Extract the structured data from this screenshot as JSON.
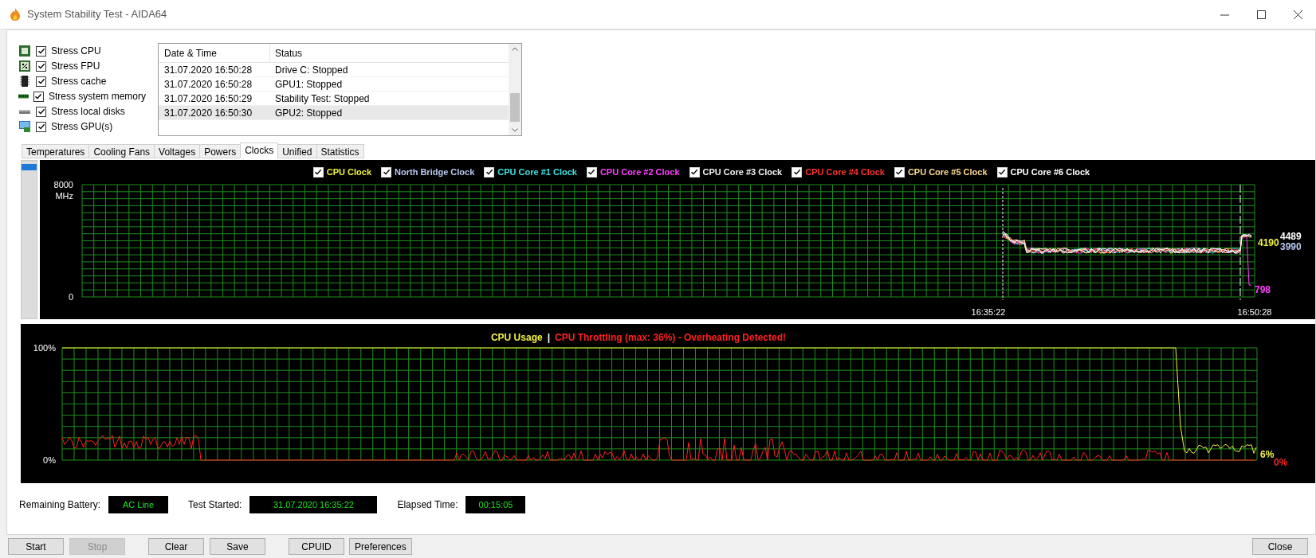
{
  "window": {
    "title": "System Stability Test - AIDA64"
  },
  "stress_options": [
    {
      "label": "Stress CPU",
      "checked": true,
      "kind": "cpu"
    },
    {
      "label": "Stress FPU",
      "checked": true,
      "kind": "fpu"
    },
    {
      "label": "Stress cache",
      "checked": true,
      "kind": "cache"
    },
    {
      "label": "Stress system memory",
      "checked": true,
      "kind": "memory"
    },
    {
      "label": "Stress local disks",
      "checked": true,
      "kind": "disk"
    },
    {
      "label": "Stress GPU(s)",
      "checked": true,
      "kind": "gpu"
    }
  ],
  "log": {
    "columns": [
      "Date & Time",
      "Status"
    ],
    "rows": [
      {
        "date_time": "31.07.2020 16:50:28",
        "status": "Drive C: Stopped",
        "selected": false
      },
      {
        "date_time": "31.07.2020 16:50:28",
        "status": "GPU1: Stopped",
        "selected": false
      },
      {
        "date_time": "31.07.2020 16:50:29",
        "status": "Stability Test: Stopped",
        "selected": false
      },
      {
        "date_time": "31.07.2020 16:50:30",
        "status": "GPU2: Stopped",
        "selected": true
      }
    ]
  },
  "tabs": [
    {
      "label": "Temperatures",
      "selected": false
    },
    {
      "label": "Cooling Fans",
      "selected": false
    },
    {
      "label": "Voltages",
      "selected": false
    },
    {
      "label": "Powers",
      "selected": false
    },
    {
      "label": "Clocks",
      "selected": true
    },
    {
      "label": "Unified",
      "selected": false
    },
    {
      "label": "Statistics",
      "selected": false
    }
  ],
  "clock_chart": {
    "legend": [
      {
        "label": "CPU Clock",
        "checked": true,
        "color": "#f0f040"
      },
      {
        "label": "North Bridge Clock",
        "checked": true,
        "color": "#b8c8f0"
      },
      {
        "label": "CPU Core #1 Clock",
        "checked": true,
        "color": "#40e0e0"
      },
      {
        "label": "CPU Core #2 Clock",
        "checked": true,
        "color": "#ff40ff"
      },
      {
        "label": "CPU Core #3 Clock",
        "checked": true,
        "color": "#f0f0f0"
      },
      {
        "label": "CPU Core #4 Clock",
        "checked": true,
        "color": "#ff3030"
      },
      {
        "label": "CPU Core #5 Clock",
        "checked": true,
        "color": "#ffd890"
      },
      {
        "label": "CPU Core #6 Clock",
        "checked": true,
        "color": "#ffffff"
      }
    ],
    "y_max_label": "8000",
    "y_unit": "MHz",
    "y_min_label": "0",
    "x_labels": [
      "16:35:22",
      "16:50:28"
    ],
    "readings": [
      {
        "text": "4489",
        "color": "#ffffff"
      },
      {
        "text": "4190",
        "color": "#f0f040"
      },
      {
        "text": "3990",
        "color": "#b8c8f0"
      },
      {
        "text": "798",
        "color": "#ff40ff"
      }
    ]
  },
  "usage_chart": {
    "legend": [
      {
        "label": "CPU Usage",
        "color": "#f0f040"
      },
      {
        "label": "|",
        "color": "#ffffff"
      },
      {
        "label": "CPU Throttling (max: 36%) - Overheating Detected!",
        "color": "#ff2020"
      }
    ],
    "y_max_label": "100%",
    "y_min_label": "0%",
    "readings": [
      {
        "text": "6%",
        "color": "#f0f040"
      },
      {
        "text": "0%",
        "color": "#ff2020"
      }
    ]
  },
  "status_fields": [
    {
      "label": "Remaining Battery:",
      "value": "AC Line"
    },
    {
      "label": "Test Started:",
      "value": "31.07.2020 16:35:22"
    },
    {
      "label": "Elapsed Time:",
      "value": "00:15:05"
    }
  ],
  "buttons": [
    {
      "label": "Start",
      "disabled": false
    },
    {
      "label": "Stop",
      "disabled": true
    },
    {
      "label": "Clear",
      "disabled": false
    },
    {
      "label": "Save",
      "disabled": false
    },
    {
      "label": "CPUID",
      "disabled": false
    },
    {
      "label": "Preferences",
      "disabled": false
    },
    {
      "label": "Close",
      "disabled": false
    }
  ]
}
